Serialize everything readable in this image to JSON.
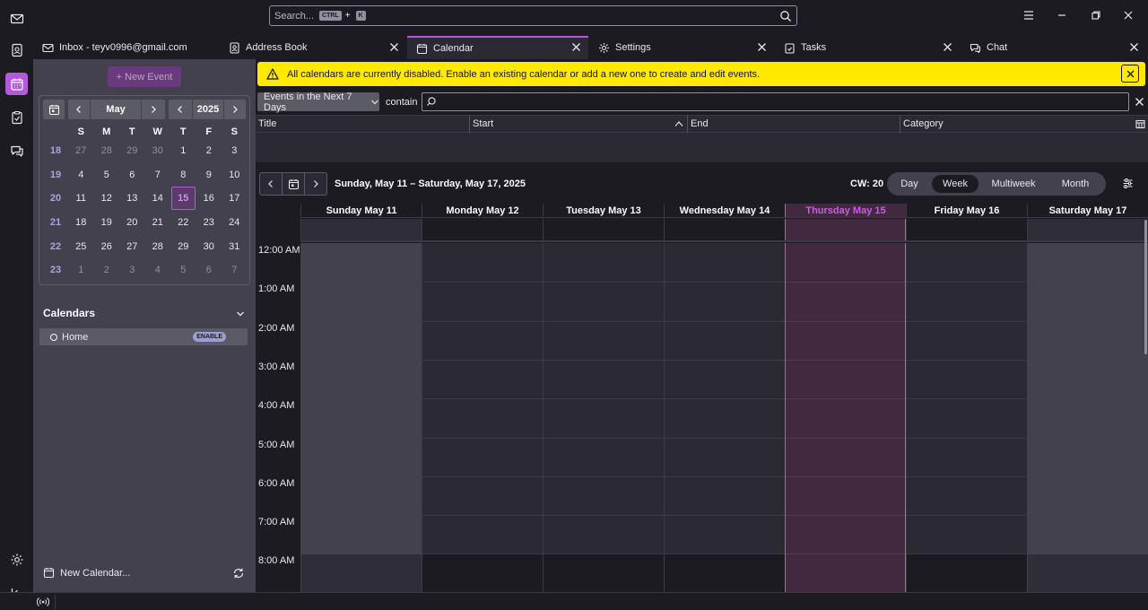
{
  "search": {
    "placeholder": "Search...",
    "key1": "CTRL",
    "plus": "+",
    "key2": "K"
  },
  "tabs": [
    {
      "label": "Inbox - teyv0996@gmail.com",
      "icon": "envelope-icon"
    },
    {
      "label": "Address Book",
      "icon": "address-book-icon"
    },
    {
      "label": "Calendar",
      "icon": "calendar-icon",
      "selected": true
    },
    {
      "label": "Settings",
      "icon": "gear-icon"
    },
    {
      "label": "Tasks",
      "icon": "tasks-icon"
    },
    {
      "label": "Chat",
      "icon": "chat-icon"
    }
  ],
  "sidebar": {
    "new_event": "+ New Event",
    "minimonth": {
      "month": "May",
      "year": "2025",
      "dow": [
        "S",
        "M",
        "T",
        "W",
        "T",
        "F",
        "S"
      ],
      "weeks": [
        {
          "wk": "18",
          "days": [
            "27",
            "28",
            "29",
            "30",
            "1",
            "2",
            "3"
          ]
        },
        {
          "wk": "19",
          "days": [
            "4",
            "5",
            "6",
            "7",
            "8",
            "9",
            "10"
          ]
        },
        {
          "wk": "20",
          "days": [
            "11",
            "12",
            "13",
            "14",
            "15",
            "16",
            "17"
          ]
        },
        {
          "wk": "21",
          "days": [
            "18",
            "19",
            "20",
            "21",
            "22",
            "23",
            "24"
          ]
        },
        {
          "wk": "22",
          "days": [
            "25",
            "26",
            "27",
            "28",
            "29",
            "30",
            "31"
          ]
        },
        {
          "wk": "23",
          "days": [
            "1",
            "2",
            "3",
            "4",
            "5",
            "6",
            "7"
          ]
        }
      ],
      "today": "15"
    },
    "calendars_header": "Calendars",
    "calendar_item": {
      "name": "Home",
      "badge": "ENABLE"
    },
    "new_calendar": "New Calendar..."
  },
  "notice": {
    "text": "All calendars are currently disabled. Enable an existing calendar or add a new one to create and edit events.",
    "color": "#ffe900"
  },
  "filter": {
    "select": "Events in the Next 7 Days",
    "contain": "contain"
  },
  "table": {
    "columns": [
      "Title",
      "Start",
      "End",
      "Category"
    ]
  },
  "view": {
    "range": "Sunday, May 11 – Saturday, May 17, 2025",
    "cw": "CW: 20",
    "modes": [
      "Day",
      "Week",
      "Multiweek",
      "Month"
    ],
    "selected_mode": "Week"
  },
  "week": {
    "days": [
      "Sunday May 11",
      "Monday May 12",
      "Tuesday May 13",
      "Wednesday May 14",
      "Thursday May 15",
      "Friday May 16",
      "Saturday May 17"
    ],
    "today_index": 4,
    "hours": [
      "12:00 AM",
      "1:00 AM",
      "2:00 AM",
      "3:00 AM",
      "4:00 AM",
      "5:00 AM",
      "6:00 AM",
      "7:00 AM",
      "8:00 AM"
    ]
  },
  "colors": {
    "accent": "#b35ad8",
    "notice": "#ffe900",
    "background": "#1c1b22"
  }
}
